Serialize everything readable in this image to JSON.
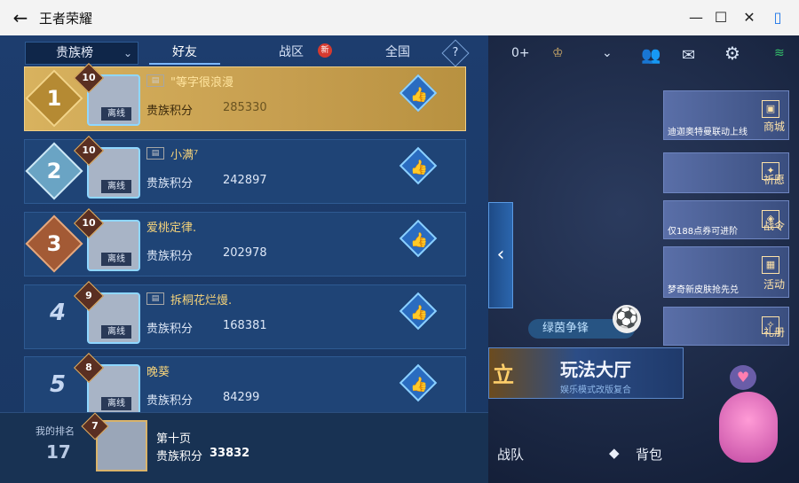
{
  "window": {
    "title": "王者荣耀",
    "back_icon": "←",
    "minimize_icon": "—",
    "maximize_icon": "☐",
    "close_icon": "✕",
    "sidebar_icon": "▯"
  },
  "leaderboard": {
    "dropdown_label": "贵族榜",
    "tabs": [
      {
        "label": "好友",
        "active": true
      },
      {
        "label": "战区",
        "badge": "新"
      },
      {
        "label": "全国"
      }
    ],
    "help_label": "?",
    "score_label": "贵族积分",
    "offline_label": "离线",
    "rows": [
      {
        "rank": "1",
        "level": "10",
        "name": "\"等字很浪漫",
        "score": "285330"
      },
      {
        "rank": "2",
        "level": "10",
        "name": "小满⁷",
        "score": "242897"
      },
      {
        "rank": "3",
        "level": "10",
        "name": "爱桃定律.",
        "score": "202978"
      },
      {
        "rank": "4",
        "level": "9",
        "name": "拆桐花烂熳.",
        "score": "168381"
      },
      {
        "rank": "5",
        "level": "8",
        "name": "晚葵",
        "score": "84299"
      }
    ],
    "my": {
      "rank_label": "我的排名",
      "rank": "17",
      "level": "7",
      "name": "第十页",
      "score_label": "贵族积分",
      "score": "33832"
    }
  },
  "lobby": {
    "coins": "0+",
    "tiles": [
      {
        "caption": "迪迦奥特曼联动上线",
        "tag": "商城"
      },
      {
        "caption": "",
        "tag": "祈愿"
      },
      {
        "caption": "仅188点券可进阶",
        "tag": "战令"
      },
      {
        "caption": "梦奇新皮肤抢先兑",
        "tag": "活动"
      },
      {
        "caption": "",
        "tag": "礼册"
      }
    ],
    "banner": "绿茵争锋",
    "play_hall": "玩法大厅",
    "play_hall_sub": "娱乐模式改版复合",
    "play_left": "立",
    "nav_team": "战队",
    "nav_bag": "背包"
  }
}
